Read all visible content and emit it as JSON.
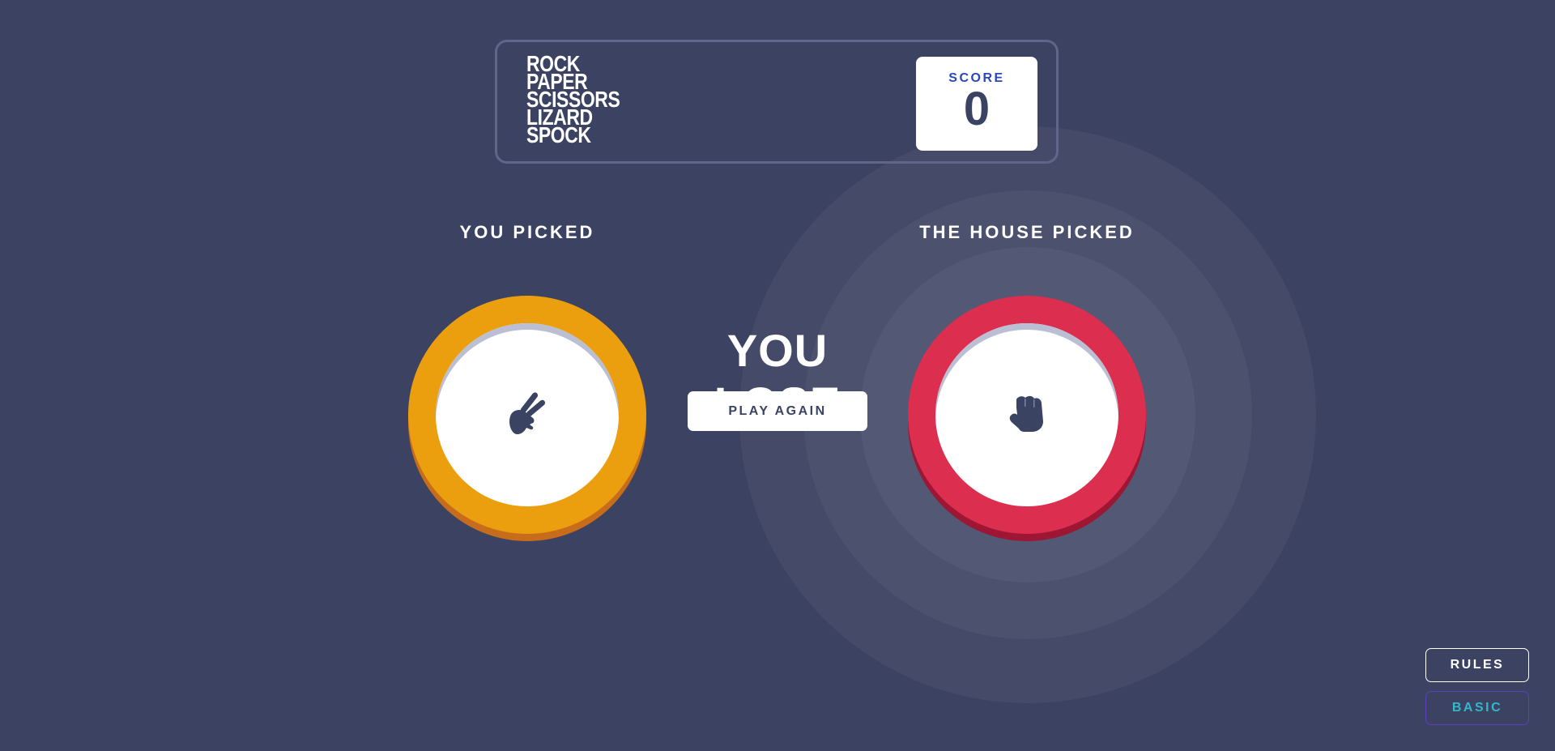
{
  "header": {
    "logo_lines": [
      "ROCK",
      "PAPER",
      "SCISSORS",
      "LIZARD",
      "SPOCK"
    ],
    "score_label": "SCORE",
    "score_value": "0"
  },
  "game": {
    "you_label": "YOU PICKED",
    "house_label": "THE HOUSE PICKED",
    "player_pick": "scissors",
    "house_pick": "rock",
    "result": "YOU LOSE",
    "play_again_label": "PLAY AGAIN"
  },
  "footer": {
    "rules_label": "RULES",
    "mode_label": "BASIC"
  },
  "colors": {
    "background": "#3c4262",
    "scissors": "#eb9f0e",
    "rock": "#dc2e4e",
    "score_label": "#2a46c0",
    "mode_label": "#33b7c9"
  },
  "icons": {
    "player": "scissors-hand-icon",
    "house": "rock-fist-icon"
  }
}
